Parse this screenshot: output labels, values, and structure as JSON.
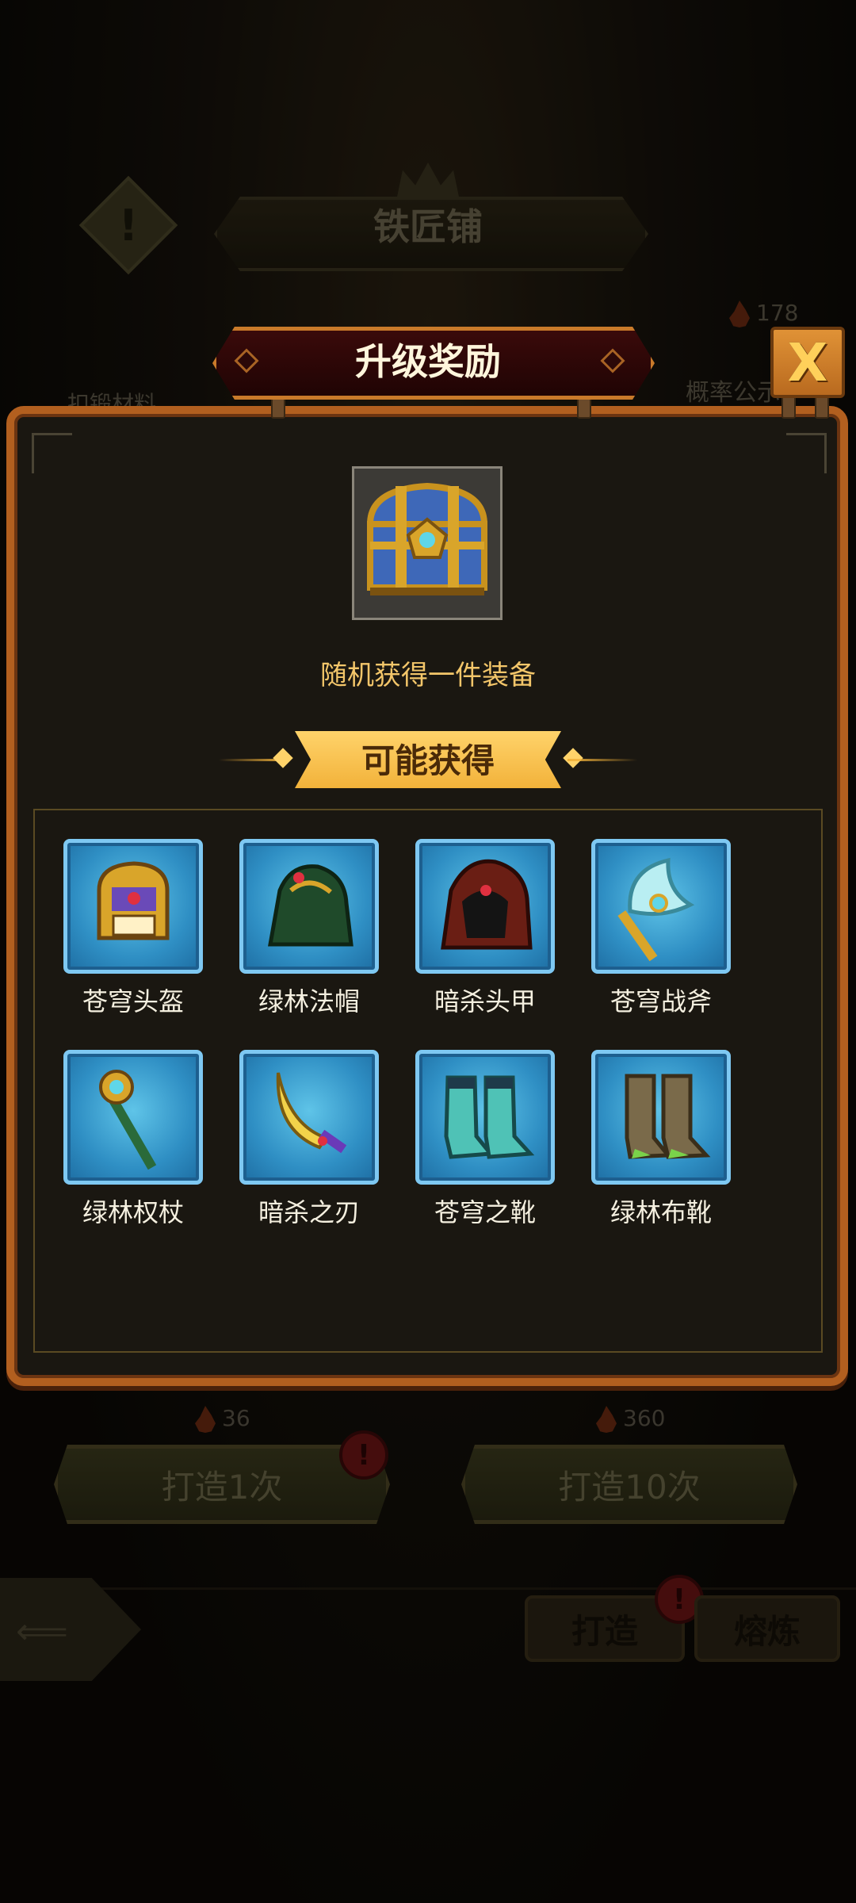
{
  "background": {
    "shop_title": "铁匠铺",
    "currency_amount": "178",
    "probability_label": "概率公示",
    "material_label": "扣锻材料",
    "forge_once": {
      "cost": "36",
      "label": "打造1次"
    },
    "forge_ten": {
      "cost": "360",
      "label": "打造10次"
    },
    "tab_forge": "打造",
    "tab_smelt": "熔炼",
    "badge_mark": "!",
    "warning_mark": "!"
  },
  "modal": {
    "title": "升级奖励",
    "close_label": "X",
    "reward_description": "随机获得一件装备",
    "possible_header": "可能获得",
    "items": [
      {
        "name": "苍穹头盔",
        "icon": "gold-helmet-icon"
      },
      {
        "name": "绿林法帽",
        "icon": "green-hood-icon"
      },
      {
        "name": "暗杀头甲",
        "icon": "dark-hood-icon"
      },
      {
        "name": "苍穹战斧",
        "icon": "battle-axe-icon"
      },
      {
        "name": "绿林权杖",
        "icon": "scepter-icon"
      },
      {
        "name": "暗杀之刃",
        "icon": "curved-blade-icon"
      },
      {
        "name": "苍穹之靴",
        "icon": "teal-boots-icon"
      },
      {
        "name": "绿林布靴",
        "icon": "brown-boots-icon"
      }
    ]
  },
  "colors": {
    "panel_border": "#b25f1f",
    "slot_blue": "#2f8fc4",
    "gold_text": "#f3c66a",
    "ribbon_gold": "#ffd36a"
  }
}
